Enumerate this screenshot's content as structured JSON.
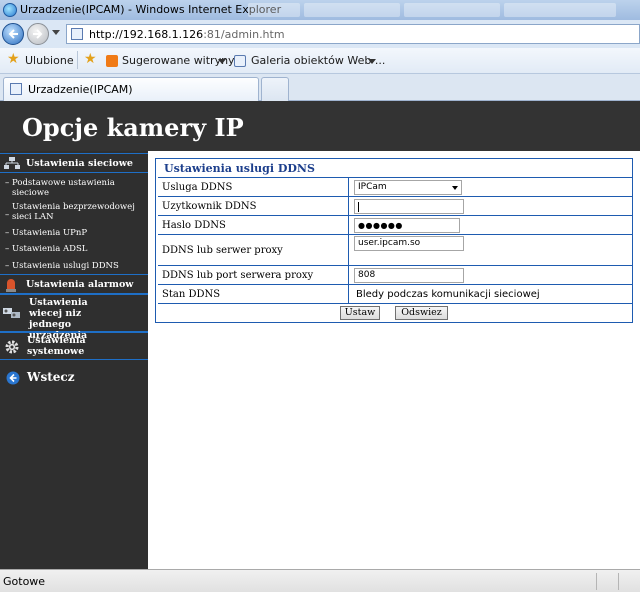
{
  "window": {
    "title": "Urzadzenie(IPCAM) - Windows Internet Explorer"
  },
  "address": {
    "url_host": "http://192.168.1.126",
    "url_rest": ":81/admin.htm"
  },
  "favorites_bar": {
    "favorites_label": "Ulubione",
    "suggested_label": "Sugerowane witryny",
    "gallery_label": "Galeria obiektów Web ..."
  },
  "tab": {
    "label": "Urzadzenie(IPCAM)"
  },
  "page": {
    "header_title": "Opcje kamery IP",
    "sidebar": {
      "network_settings": "Ustawienia sieciowe",
      "sub_basic": "Podstawowe ustawienia sieciowe",
      "sub_wireless": "Ustawienia bezprzewodowej sieci LAN",
      "sub_upnp": "Ustawienia UPnP",
      "sub_adsl": "Ustawienia ADSL",
      "sub_ddns": "Ustawienia uslugi DDNS",
      "alarm_settings": "Ustawienia alarmow",
      "multi_device": "Ustawienia wiecej niz jednego urzadzenia",
      "system_settings": "Ustawienia systemowe",
      "back": "Wstecz"
    },
    "ddns": {
      "panel_title": "Ustawienia uslugi DDNS",
      "service_label": "Usluga DDNS",
      "service_value": "IPCam",
      "user_label": "Uzytkownik DDNS",
      "user_value": "",
      "password_label": "Haslo DDNS",
      "password_value": "●●●●●●",
      "proxy_server_label": "DDNS lub serwer proxy",
      "proxy_server_value": "user.ipcam.so",
      "proxy_port_label": "DDNS lub port serwera proxy",
      "proxy_port_value": "808",
      "status_label": "Stan DDNS",
      "status_value": "Bledy podczas komunikacji sieciowej",
      "apply_button": "Ustaw",
      "refresh_button": "Odswiez"
    }
  },
  "statusbar": {
    "text": "Gotowe"
  },
  "colors": {
    "header_bg": "#333333",
    "sidebar_bg": "#2f2f2f",
    "accent_blue": "#1e5bb0",
    "panel_title": "#1d3f8c"
  }
}
